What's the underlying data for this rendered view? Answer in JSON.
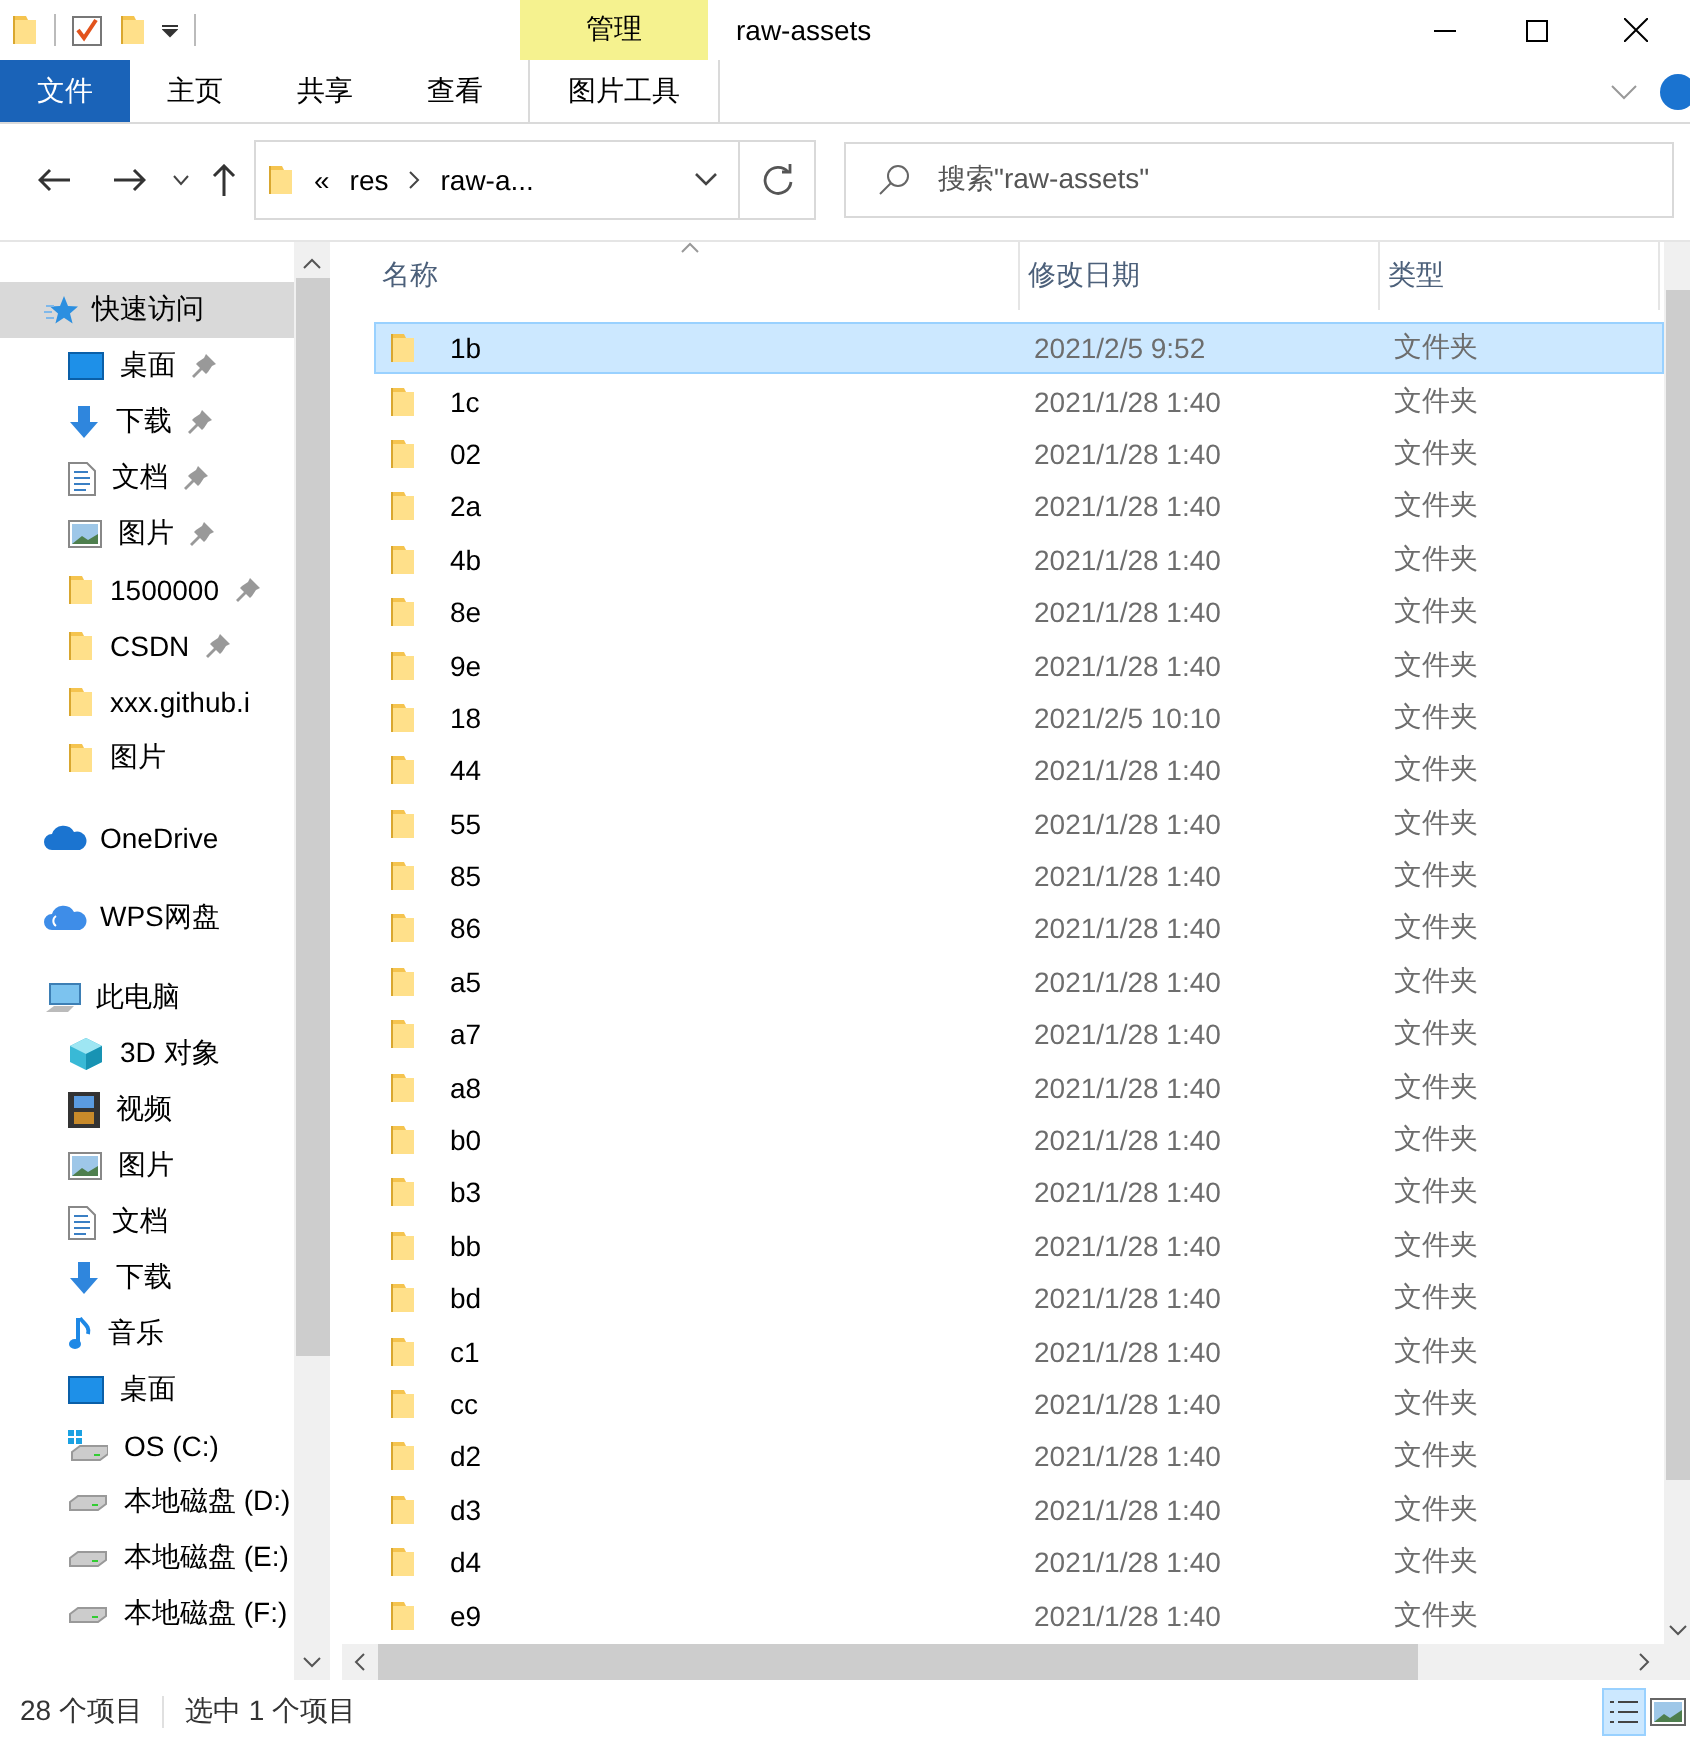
{
  "window": {
    "title": "raw-assets",
    "context_group": "管理"
  },
  "ribbon_tabs": [
    {
      "label": "文件",
      "kind": "file"
    },
    {
      "label": "主页",
      "kind": "normal"
    },
    {
      "label": "共享",
      "kind": "normal"
    },
    {
      "label": "查看",
      "kind": "normal"
    },
    {
      "label": "图片工具",
      "kind": "context"
    }
  ],
  "address_bar": {
    "overflow": "«",
    "path": [
      "res",
      "raw-a..."
    ]
  },
  "search": {
    "placeholder": "搜索\"raw-assets\""
  },
  "nav_pane": {
    "items": [
      {
        "label": "快速访问",
        "kind": "star",
        "selected": true,
        "children": [
          {
            "label": "桌面",
            "kind": "desktop",
            "pinned": true
          },
          {
            "label": "下载",
            "kind": "download",
            "pinned": true
          },
          {
            "label": "文档",
            "kind": "document",
            "pinned": true
          },
          {
            "label": "图片",
            "kind": "picture",
            "pinned": true
          },
          {
            "label": "1500000",
            "kind": "folder",
            "pinned": true
          },
          {
            "label": "CSDN",
            "kind": "folder",
            "pinned": true
          },
          {
            "label": "xxx.github.i",
            "kind": "folder",
            "pinned": false
          },
          {
            "label": "图片",
            "kind": "folder",
            "pinned": false
          }
        ]
      },
      {
        "label": "OneDrive",
        "kind": "cloud",
        "selected": false
      },
      {
        "label": "WPS网盘",
        "kind": "cloud2",
        "selected": false
      },
      {
        "label": "此电脑",
        "kind": "pc",
        "selected": false,
        "children": [
          {
            "label": "3D 对象",
            "kind": "cube"
          },
          {
            "label": "视频",
            "kind": "film"
          },
          {
            "label": "图片",
            "kind": "picture"
          },
          {
            "label": "文档",
            "kind": "document"
          },
          {
            "label": "下载",
            "kind": "download"
          },
          {
            "label": "音乐",
            "kind": "music"
          },
          {
            "label": "桌面",
            "kind": "desktop"
          },
          {
            "label": "OS (C:)",
            "kind": "osdrive"
          },
          {
            "label": "本地磁盘 (D:)",
            "kind": "drive"
          },
          {
            "label": "本地磁盘 (E:)",
            "kind": "drive"
          },
          {
            "label": "本地磁盘 (F:)",
            "kind": "drive"
          }
        ]
      }
    ]
  },
  "file_list": {
    "columns": [
      "名称",
      "修改日期",
      "类型"
    ],
    "rows": [
      {
        "name": "1b",
        "modified": "2021/2/5 9:52",
        "type": "文件夹",
        "selected": true
      },
      {
        "name": "1c",
        "modified": "2021/1/28 1:40",
        "type": "文件夹",
        "selected": false
      },
      {
        "name": "02",
        "modified": "2021/1/28 1:40",
        "type": "文件夹",
        "selected": false
      },
      {
        "name": "2a",
        "modified": "2021/1/28 1:40",
        "type": "文件夹",
        "selected": false
      },
      {
        "name": "4b",
        "modified": "2021/1/28 1:40",
        "type": "文件夹",
        "selected": false
      },
      {
        "name": "8e",
        "modified": "2021/1/28 1:40",
        "type": "文件夹",
        "selected": false
      },
      {
        "name": "9e",
        "modified": "2021/1/28 1:40",
        "type": "文件夹",
        "selected": false
      },
      {
        "name": "18",
        "modified": "2021/2/5 10:10",
        "type": "文件夹",
        "selected": false
      },
      {
        "name": "44",
        "modified": "2021/1/28 1:40",
        "type": "文件夹",
        "selected": false
      },
      {
        "name": "55",
        "modified": "2021/1/28 1:40",
        "type": "文件夹",
        "selected": false
      },
      {
        "name": "85",
        "modified": "2021/1/28 1:40",
        "type": "文件夹",
        "selected": false
      },
      {
        "name": "86",
        "modified": "2021/1/28 1:40",
        "type": "文件夹",
        "selected": false
      },
      {
        "name": "a5",
        "modified": "2021/1/28 1:40",
        "type": "文件夹",
        "selected": false
      },
      {
        "name": "a7",
        "modified": "2021/1/28 1:40",
        "type": "文件夹",
        "selected": false
      },
      {
        "name": "a8",
        "modified": "2021/1/28 1:40",
        "type": "文件夹",
        "selected": false
      },
      {
        "name": "b0",
        "modified": "2021/1/28 1:40",
        "type": "文件夹",
        "selected": false
      },
      {
        "name": "b3",
        "modified": "2021/1/28 1:40",
        "type": "文件夹",
        "selected": false
      },
      {
        "name": "bb",
        "modified": "2021/1/28 1:40",
        "type": "文件夹",
        "selected": false
      },
      {
        "name": "bd",
        "modified": "2021/1/28 1:40",
        "type": "文件夹",
        "selected": false
      },
      {
        "name": "c1",
        "modified": "2021/1/28 1:40",
        "type": "文件夹",
        "selected": false
      },
      {
        "name": "cc",
        "modified": "2021/1/28 1:40",
        "type": "文件夹",
        "selected": false
      },
      {
        "name": "d2",
        "modified": "2021/1/28 1:40",
        "type": "文件夹",
        "selected": false
      },
      {
        "name": "d3",
        "modified": "2021/1/28 1:40",
        "type": "文件夹",
        "selected": false
      },
      {
        "name": "d4",
        "modified": "2021/1/28 1:40",
        "type": "文件夹",
        "selected": false
      },
      {
        "name": "e9",
        "modified": "2021/1/28 1:40",
        "type": "文件夹",
        "selected": false
      }
    ]
  },
  "status_bar": {
    "item_count": "28 个项目",
    "selection": "选中 1 个项目"
  },
  "view_buttons": [
    {
      "kind": "details",
      "selected": true
    },
    {
      "kind": "thumbnails",
      "selected": false
    }
  ]
}
